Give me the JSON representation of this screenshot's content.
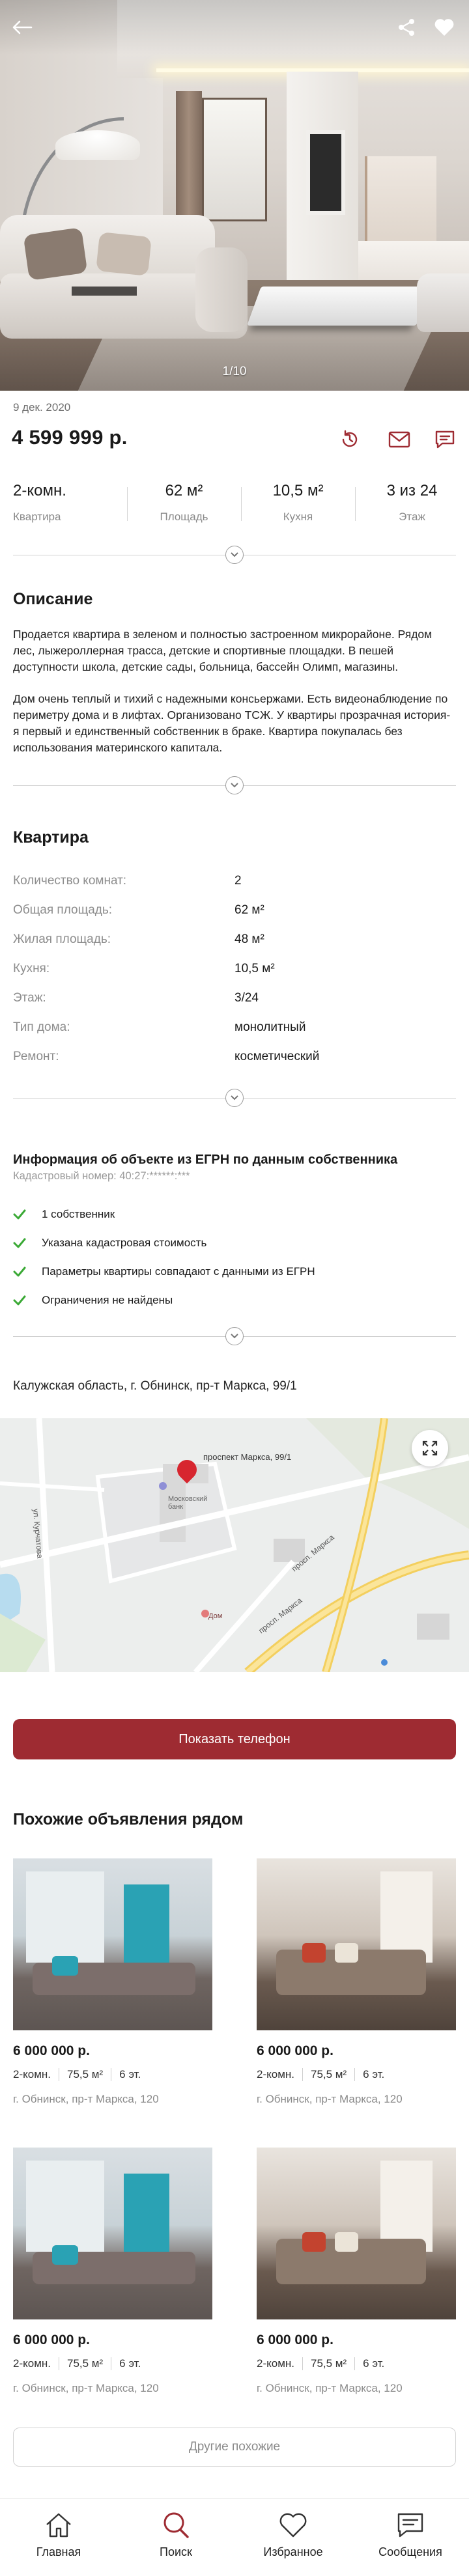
{
  "gallery": {
    "counter": "1/10"
  },
  "listing": {
    "date": "9 дек. 2020",
    "price": "4 599 999 р."
  },
  "facts": [
    {
      "value": "2-комн.",
      "label": "Квартира"
    },
    {
      "value": "62 м²",
      "label": "Площадь"
    },
    {
      "value": "10,5 м²",
      "label": "Кухня"
    },
    {
      "value": "3 из 24",
      "label": "Этаж"
    }
  ],
  "description": {
    "title": "Описание",
    "p1": "Продается квартира в зеленом и полностью застроенном микрорайоне. Рядом лес, лыжероллерная трасса, детские и спортивные площадки. В пешей доступности школа, детские сады, больница, бассейн Олимп, магазины.",
    "p2": "Дом очень теплый и тихий с надежными консьержами. Есть видеонаблюдение по периметру дома и в лифтах. Организовано ТСЖ. У квартиры прозрачная история- я первый и единственный собственник в браке. Квартира покупалась без использования материнского капитала."
  },
  "apartment": {
    "title": "Квартира",
    "rows": [
      {
        "key": "Количество комнат:",
        "value": "2"
      },
      {
        "key": "Общая площадь:",
        "value": "62 м²"
      },
      {
        "key": "Жилая площадь:",
        "value": "48 м²"
      },
      {
        "key": "Кухня:",
        "value": "10,5 м²"
      },
      {
        "key": "Этаж:",
        "value": "3/24"
      },
      {
        "key": "Тип дома:",
        "value": "монолитный"
      },
      {
        "key": "Ремонт:",
        "value": "косметический"
      }
    ]
  },
  "egrn": {
    "title": "Информация об объекте из ЕГРН по данным собственника",
    "cadastral": "Кадастровый номер: 40:27:******:***",
    "checks": [
      "1 собственник",
      "Указана кадастровая стоимость",
      "Параметры квартиры совпадают с данными из ЕГРН",
      "Ограничения не найдены"
    ]
  },
  "location": {
    "address": "Калужская область, г. Обнинск, пр-т Маркса, 99/1",
    "pin_label": "проспект Маркса, 99/1",
    "street_labels": [
      "просп. Маркса",
      "просп. Маркса",
      "ул. Курчатова"
    ],
    "poi_1": "Московский банк",
    "poi_2": "Дом"
  },
  "actions": {
    "call": "Показать телефон",
    "more": "Другие похожие"
  },
  "similar": {
    "title": "Похожие объявления рядом",
    "cards": [
      {
        "price": "6 000 000 р.",
        "rooms": "2-комн.",
        "area": "75,5 м²",
        "floor": "6 эт.",
        "address": "г. Обнинск, пр-т Маркса, 120"
      },
      {
        "price": "6 000 000 р.",
        "rooms": "2-комн.",
        "area": "75,5 м²",
        "floor": "6 эт.",
        "address": "г. Обнинск, пр-т Маркса, 120"
      },
      {
        "price": "6 000 000 р.",
        "rooms": "2-комн.",
        "area": "75,5 м²",
        "floor": "6 эт.",
        "address": "г. Обнинск, пр-т Маркса, 120"
      },
      {
        "price": "6 000 000 р.",
        "rooms": "2-комн.",
        "area": "75,5 м²",
        "floor": "6 эт.",
        "address": "г. Обнинск, пр-т Маркса, 120"
      }
    ]
  },
  "tabs": [
    {
      "label": "Главная",
      "icon": "home-icon"
    },
    {
      "label": "Поиск",
      "icon": "search-icon"
    },
    {
      "label": "Избранное",
      "icon": "heart-icon"
    },
    {
      "label": "Сообщения",
      "icon": "chat-icon"
    }
  ],
  "colors": {
    "accent": "#9e2b32",
    "check": "#3aa935"
  }
}
